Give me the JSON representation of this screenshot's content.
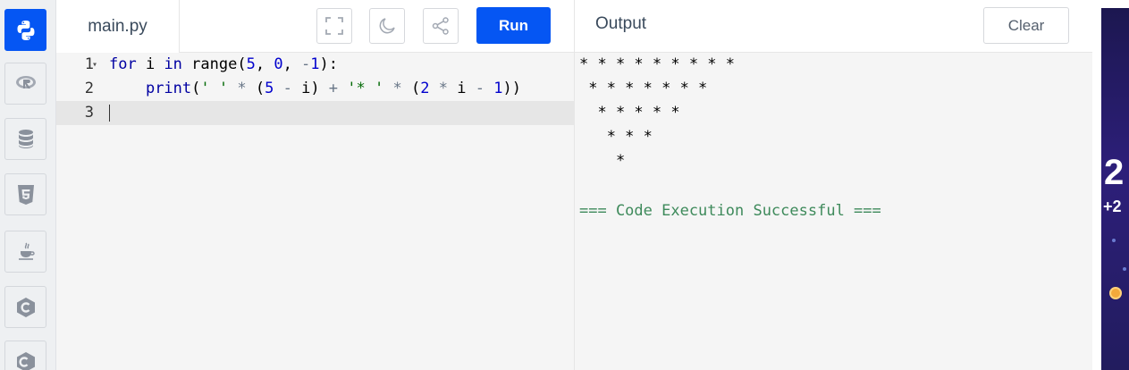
{
  "sidebar": {
    "languages": [
      {
        "name": "Python",
        "icon": "python-icon",
        "active": true
      },
      {
        "name": "R",
        "icon": "r-icon"
      },
      {
        "name": "SQL",
        "icon": "database-icon"
      },
      {
        "name": "HTML",
        "icon": "html5-icon"
      },
      {
        "name": "Java",
        "icon": "java-icon"
      },
      {
        "name": "C",
        "icon": "c-icon"
      },
      {
        "name": "C++",
        "icon": "cpp-icon"
      }
    ]
  },
  "editor": {
    "file_name": "main.py",
    "toolbar": {
      "fullscreen_icon": "fullscreen-icon",
      "theme_icon": "moon-icon",
      "share_icon": "share-icon",
      "run_label": "Run"
    },
    "lines": [
      {
        "number": "1",
        "text": "for i in range(5, 0, -1):"
      },
      {
        "number": "2",
        "text": "    print(' ' * (5 - i) + '* ' * (2 * i - 1))"
      },
      {
        "number": "3",
        "text": ""
      }
    ],
    "active_line": "3"
  },
  "output": {
    "title": "Output",
    "clear_label": "Clear",
    "lines": [
      "* * * * * * * * * ",
      " * * * * * * * ",
      "  * * * * * ",
      "   * * * ",
      "    * ",
      "",
      "=== Code Execution Successful ==="
    ]
  },
  "ad": {
    "big_text": "2",
    "small_text": "+2"
  },
  "colors": {
    "accent": "#0556f3",
    "success": "#3e8a5b",
    "keyword": "#0000a2",
    "string": "#036a07"
  }
}
